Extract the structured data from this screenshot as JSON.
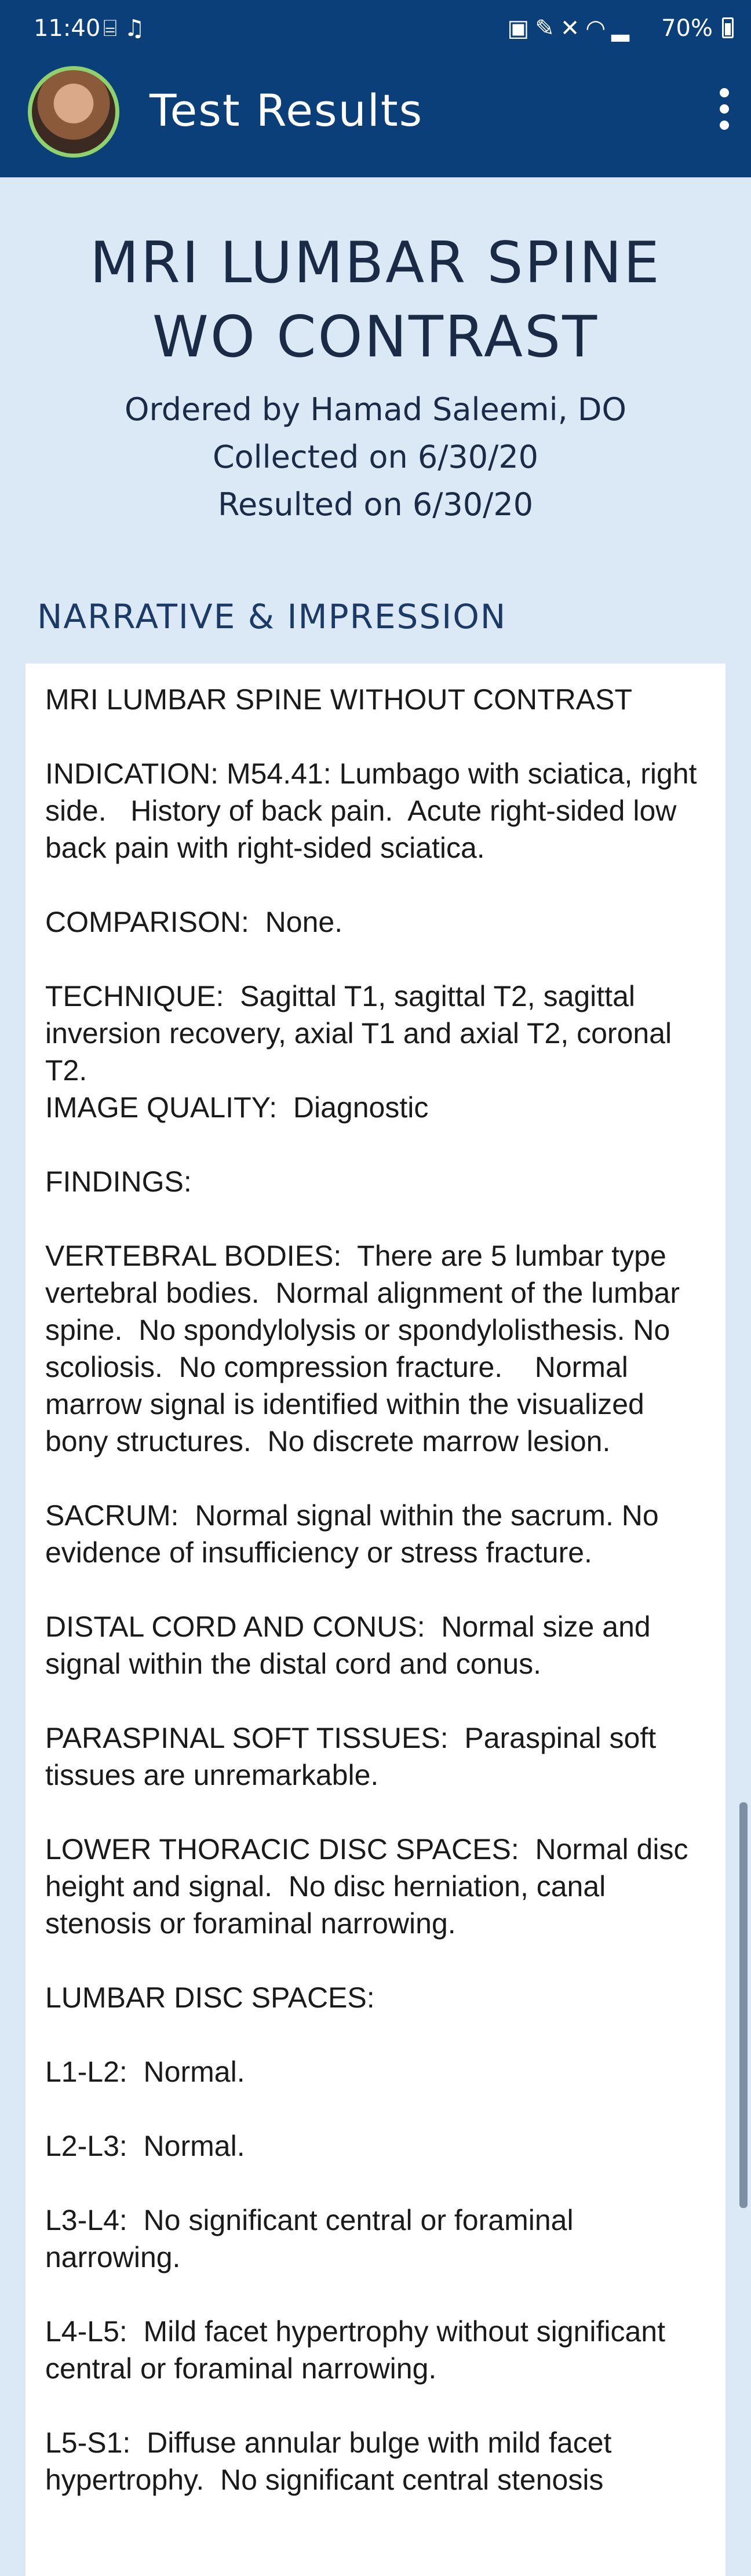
{
  "status_bar": {
    "time": "11:40",
    "battery": "70%",
    "left_icons": [
      "voicemail-icon",
      "alarm-icon"
    ],
    "right_icons": [
      "lock-icon",
      "pen-icon",
      "mute-icon",
      "wifi-icon",
      "signal-icon"
    ]
  },
  "app_bar": {
    "title": "Test Results"
  },
  "report": {
    "title": "MRI LUMBAR SPINE WO CONTRAST",
    "ordered_by": "Ordered by Hamad Saleemi, DO",
    "collected": "Collected on 6/30/20",
    "resulted": "Resulted on 6/30/20"
  },
  "section": {
    "title": "NARRATIVE & IMPRESSION"
  },
  "narrative": [
    "MRI LUMBAR SPINE WITHOUT CONTRAST",
    "INDICATION: M54.41: Lumbago with sciatica, right side.   History of back pain.  Acute right-sided low back pain with right-sided sciatica.",
    "COMPARISON:  None.",
    "TECHNIQUE:  Sagittal T1, sagittal T2, sagittal inversion recovery, axial T1 and axial T2, coronal T2.",
    "IMAGE QUALITY:  Diagnostic",
    "FINDINGS:",
    "VERTEBRAL BODIES:  There are 5 lumbar type vertebral bodies.  Normal alignment of the lumbar spine.  No spondylolysis or spondylolisthesis. No scoliosis.  No compression fracture.    Normal marrow signal is identified within the visualized bony structures.  No discrete marrow lesion.",
    "SACRUM:  Normal signal within the sacrum. No evidence of insufficiency or stress fracture.",
    "DISTAL CORD AND CONUS:  Normal size and signal within the distal cord and conus.",
    "PARASPINAL SOFT TISSUES:  Paraspinal soft tissues are unremarkable.",
    "LOWER THORACIC DISC SPACES:  Normal disc height and signal.  No disc herniation, canal stenosis or foraminal narrowing.",
    "LUMBAR DISC SPACES:",
    "L1-L2:  Normal.",
    "L2-L3:  Normal.",
    "L3-L4:  No significant central or foraminal narrowing.",
    "L4-L5:  Mild facet hypertrophy without significant central or foraminal narrowing.",
    "L5-S1:  Diffuse annular bulge with mild facet hypertrophy.  No significant central stenosis"
  ],
  "colors": {
    "app_bar": "#0b3f7a",
    "background": "#dbe8f5",
    "avatar_ring": "#8fd16a"
  }
}
